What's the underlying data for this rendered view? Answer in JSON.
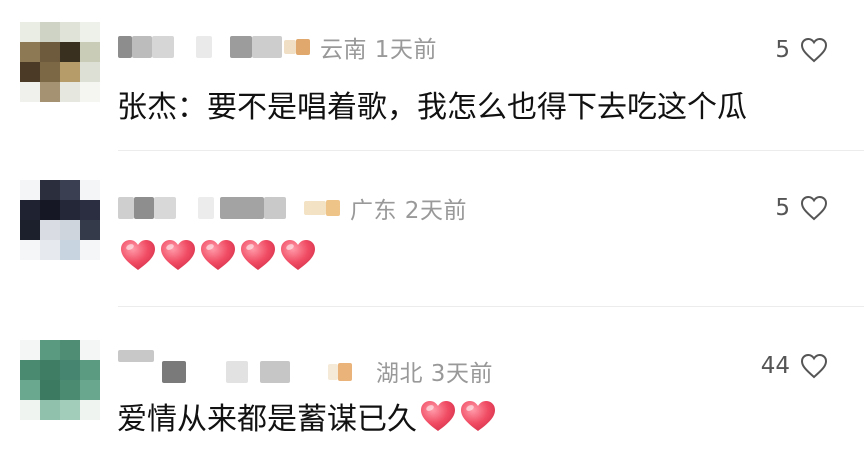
{
  "icons": {
    "like_icon": "heart-outline-icon",
    "emoji_heart": "red-heart-emoji"
  },
  "colors": {
    "location_text": "#999999",
    "like_count": "#555555",
    "content_text": "#111111",
    "heart_emoji": "#f04b63"
  },
  "comments": [
    {
      "location": "云南 1天前",
      "likes": "5",
      "text": "张杰：要不是唱着歌，我怎么也得下去吃这个瓜",
      "hearts": 0
    },
    {
      "location": "广东 2天前",
      "likes": "5",
      "text": "",
      "hearts": 5
    },
    {
      "location": "湖北 3天前",
      "likes": "44",
      "text": "爱情从来都是蓄谋已久",
      "hearts": 2
    }
  ]
}
